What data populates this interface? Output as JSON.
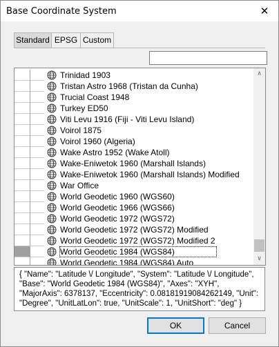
{
  "window": {
    "title": "Base Coordinate System",
    "close_glyph": "✕"
  },
  "tabs": [
    {
      "label": "Standard",
      "active": true
    },
    {
      "label": "EPSG",
      "active": false
    },
    {
      "label": "Custom",
      "active": false
    }
  ],
  "search": {
    "value": "",
    "placeholder": ""
  },
  "list": {
    "icon": "globe-icon",
    "selected_index": 16,
    "items": [
      "Trinidad 1903",
      "Tristan Astro 1968 (Tristan da Cunha)",
      "Trucial Coast 1948",
      "Turkey ED50",
      "Viti Levu 1916 (Fiji - Viti Levu Island)",
      "Voirol 1875",
      "Voirol 1960 (Algeria)",
      "Wake Astro 1952 (Wake Atoll)",
      "Wake-Eniwetok 1960 (Marshall Islands)",
      "Wake-Eniwetok 1960 (Marshall Islands) Modified",
      "War Office",
      "World Geodetic 1960 (WGS60)",
      "World Geodetic 1966 (WGS66)",
      "World Geodetic 1972 (WGS72)",
      "World Geodetic 1972 (WGS72) Modified",
      "World Geodetic 1972 (WGS72) Modified 2",
      "World Geodetic 1984 (WGS84)",
      "World Geodetic 1984 (WGS84) Auto"
    ]
  },
  "scrollbar": {
    "up_glyph": "∧",
    "down_glyph": "∨"
  },
  "details": {
    "text": "{ \"Name\": \"Latitude \\/ Longitude\", \"System\": \"Latitude \\/ Longitude\", \"Base\": \"World Geodetic 1984 (WGS84)\", \"Axes\": \"XYH\", \"MajorAxis\": 6378137, \"Eccentricity\": 0.0818191908426214​9, \"Unit\": \"Degree\", \"UnitLatLon\": true, \"UnitScale\": 1, \"UnitShort\": \"deg\" }"
  },
  "buttons": {
    "ok": "OK",
    "cancel": "Cancel"
  },
  "colors": {
    "selected_cell": "#a0a0a0",
    "ok_border": "#0078d7"
  }
}
